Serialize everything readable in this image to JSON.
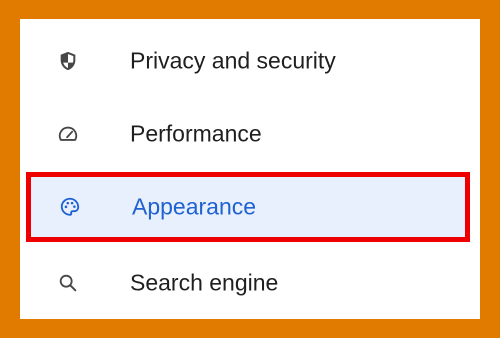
{
  "menu": {
    "items": [
      {
        "label": "Privacy and security",
        "icon": "shield-icon"
      },
      {
        "label": "Performance",
        "icon": "speedometer-icon"
      },
      {
        "label": "Appearance",
        "icon": "palette-icon",
        "selected": true
      },
      {
        "label": "Search engine",
        "icon": "search-icon"
      }
    ]
  },
  "colors": {
    "frame_background": "#e07b00",
    "selected_background": "#e8effd",
    "selected_text": "#1f62d2",
    "highlight_border": "#ee0000",
    "text": "#1f1f1f",
    "icon": "#474747"
  }
}
